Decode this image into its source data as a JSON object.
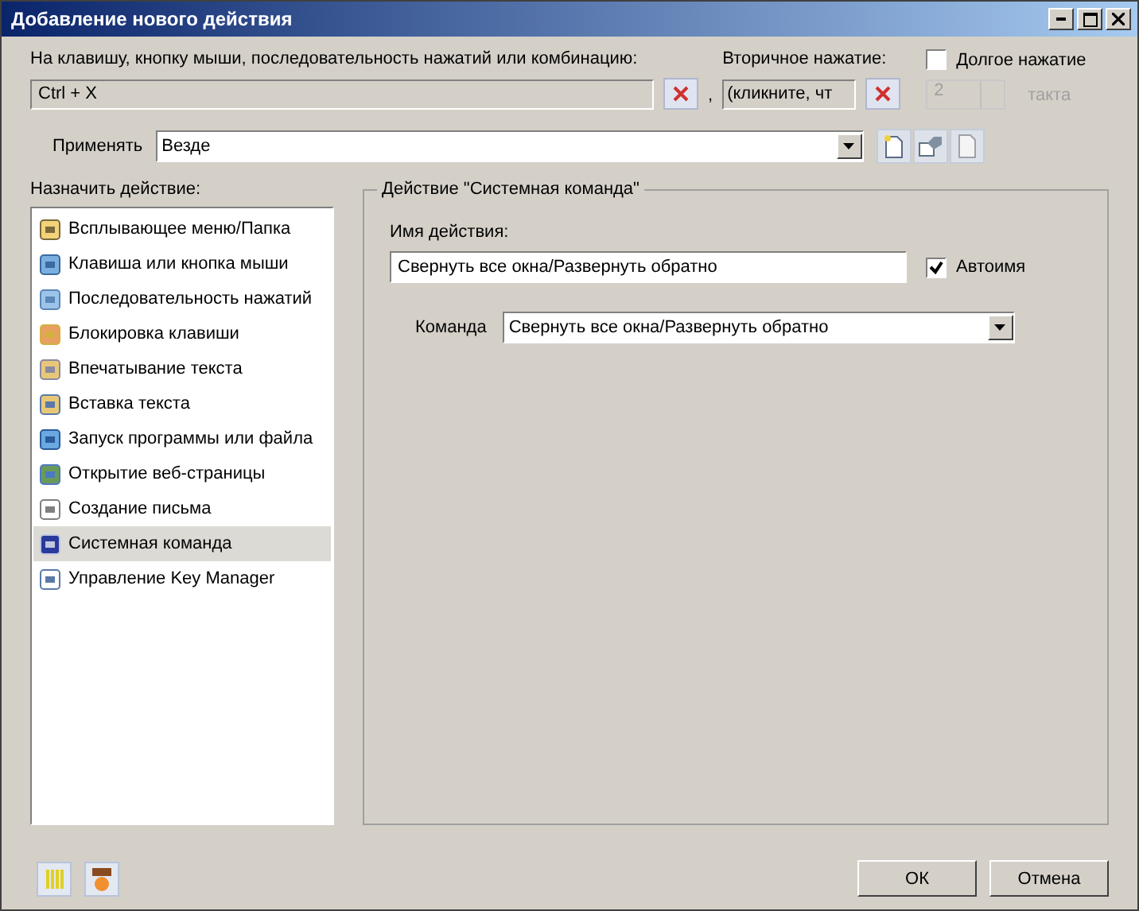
{
  "window": {
    "title": "Добавление нового действия"
  },
  "trigger": {
    "label": "На клавишу, кнопку мыши, последовательность нажатий или комбинацию:",
    "value": "Ctrl + X",
    "separator": ","
  },
  "secondary": {
    "label": "Вторичное нажатие:",
    "value": "(кликните, чт"
  },
  "long_press": {
    "label": "Долгое нажатие",
    "checked": false,
    "count": "2",
    "unit": "такта",
    "disabled": true
  },
  "apply": {
    "label": "Применять",
    "value": "Везде"
  },
  "actions_label": "Назначить действие:",
  "actions": [
    {
      "label": "Всплывающее меню/Папка",
      "kind": "menu",
      "selected": false
    },
    {
      "label": "Клавиша или кнопка мыши",
      "kind": "key",
      "selected": false
    },
    {
      "label": "Последовательность нажатий",
      "kind": "sequence",
      "selected": false
    },
    {
      "label": "Блокировка клавиши",
      "kind": "lock",
      "selected": false
    },
    {
      "label": "Впечатывание текста",
      "kind": "type",
      "selected": false
    },
    {
      "label": "Вставка текста",
      "kind": "paste",
      "selected": false
    },
    {
      "label": "Запуск программы или файла",
      "kind": "run",
      "selected": false
    },
    {
      "label": "Открытие веб-страницы",
      "kind": "web",
      "selected": false
    },
    {
      "label": "Создание письма",
      "kind": "mail",
      "selected": false
    },
    {
      "label": "Системная команда",
      "kind": "system",
      "selected": true
    },
    {
      "label": "Управление Key Manager",
      "kind": "manage",
      "selected": false
    }
  ],
  "group": {
    "title": "Действие \"Системная команда\"",
    "name_label": "Имя действия:",
    "name_value": "Свернуть все окна/Развернуть обратно",
    "autoname": {
      "label": "Автоимя",
      "checked": true
    },
    "command_label": "Команда",
    "command_value": "Свернуть все окна/Развернуть обратно"
  },
  "buttons": [
    "ОК",
    "Отмена"
  ]
}
